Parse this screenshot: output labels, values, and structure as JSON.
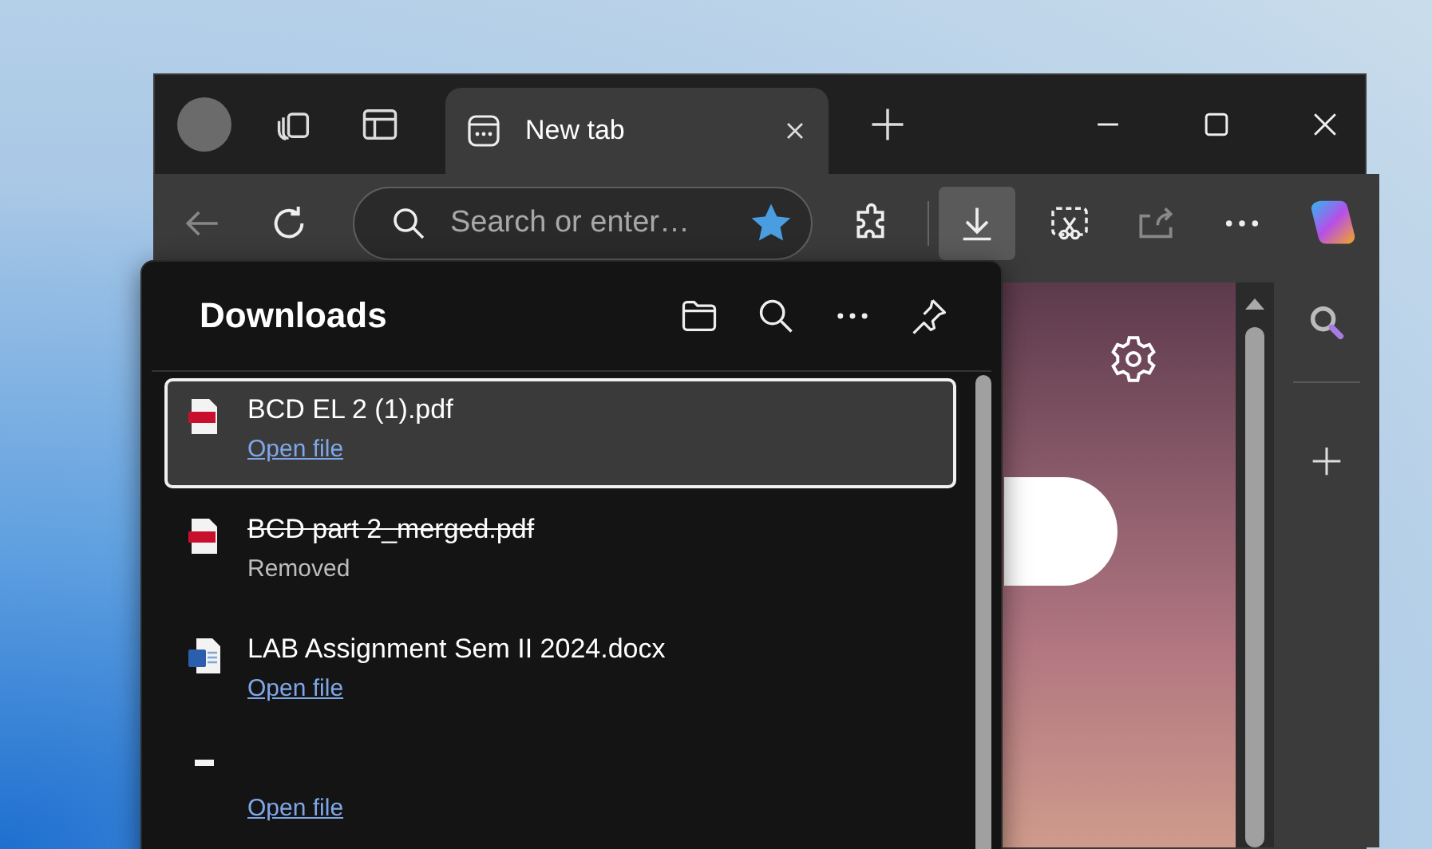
{
  "tabs": [
    {
      "title": "New tab",
      "selected": true
    }
  ],
  "address_bar": {
    "placeholder": "Search or enter…",
    "favorited": true
  },
  "toolbar": {
    "downloads_selected": true
  },
  "downloads": {
    "title": "Downloads",
    "items": [
      {
        "kind": "pdf",
        "name": "BCD EL 2 (1).pdf",
        "status": "Open file",
        "selected": true,
        "removed": false
      },
      {
        "kind": "pdf",
        "name": "BCD part 2_merged.pdf",
        "status": "Removed",
        "selected": false,
        "removed": true
      },
      {
        "kind": "docx",
        "name": "LAB Assignment Sem II 2024.docx",
        "status": "Open file",
        "selected": false,
        "removed": false
      },
      {
        "kind": "generic",
        "status": "Open file",
        "selected": false,
        "removed": false
      }
    ]
  }
}
